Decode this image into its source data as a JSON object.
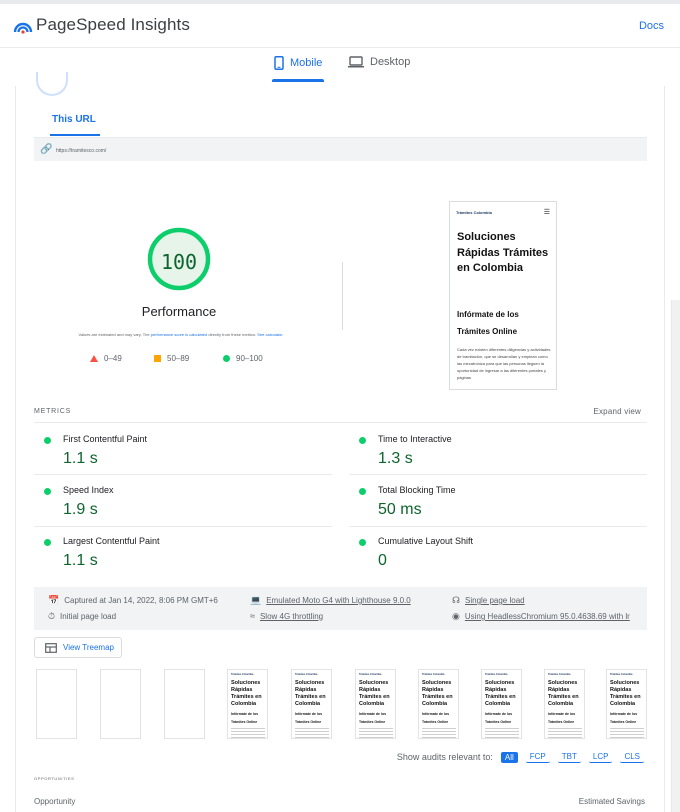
{
  "header": {
    "app_title": "PageSpeed Insights",
    "docs_label": "Docs"
  },
  "device_tabs": {
    "mobile_label": "Mobile",
    "desktop_label": "Desktop",
    "selected": "Mobile"
  },
  "report": {
    "url_tab_label": "This URL",
    "url": "https://tramitesco.com/",
    "score": "100",
    "score_label": "Performance",
    "note_text": "Values are estimated and may vary. The ",
    "note_link1": "performance score is calculated",
    "note_mid": " directly from these metrics. ",
    "note_link2": "See calculator.",
    "legend": [
      {
        "range": "0–49",
        "color": "#ff4e42"
      },
      {
        "range": "50–89",
        "color": "#ffa400"
      },
      {
        "range": "90–100",
        "color": "#0cce6b"
      }
    ]
  },
  "screenshot": {
    "logo_text": "Trámites Colombia",
    "heading": "Soluciones Rápidas Trámites en Colombia",
    "subheading": "Infórmate de los Trámites Online",
    "body": "Cada vez existen diferentes diligencias y actividades de tramitación, que se desarrollan y emplean como las mecatrónica para que las personas lleguen la oportunidad de ingresar a las diferentes portales y páginas"
  },
  "metrics": {
    "section_label": "METRICS",
    "expand_label": "Expand view",
    "items": [
      {
        "label": "First Contentful Paint",
        "value": "1.1 s",
        "status": "good"
      },
      {
        "label": "Time to Interactive",
        "value": "1.3 s",
        "status": "good"
      },
      {
        "label": "Speed Index",
        "value": "1.9 s",
        "status": "good"
      },
      {
        "label": "Total Blocking Time",
        "value": "50 ms",
        "status": "good"
      },
      {
        "label": "Largest Contentful Paint",
        "value": "1.1 s",
        "status": "good"
      },
      {
        "label": "Cumulative Layout Shift",
        "value": "0",
        "status": "good"
      }
    ]
  },
  "run_info": {
    "captured": "Captured at Jan 14, 2022, 8:06 PM GMT+6",
    "emulated": "Emulated Moto G4 with Lighthouse 9.0.0",
    "single_page": "Single page load",
    "initial_load": "Initial page load",
    "throttling": "Slow 4G throttling",
    "browser": "Using HeadlessChromium 95.0.4638.69 with lr"
  },
  "treemap_label": "View Treemap",
  "filmstrip": {
    "frame_heading": "Soluciones Rápidas Trámites en Colombia",
    "frame_subheading": "Infórmate de los Trámites Online",
    "frame_logo": "Trámites Colombia",
    "blank_frames": 3,
    "filled_frames": 7
  },
  "audit_filter": {
    "label": "Show audits relevant to:",
    "options": [
      "All",
      "FCP",
      "TBT",
      "LCP",
      "CLS"
    ],
    "selected": "All"
  },
  "opportunities": {
    "section_label": "OPPORTUNITIES",
    "col_opportunity": "Opportunity",
    "col_savings": "Estimated Savings"
  }
}
